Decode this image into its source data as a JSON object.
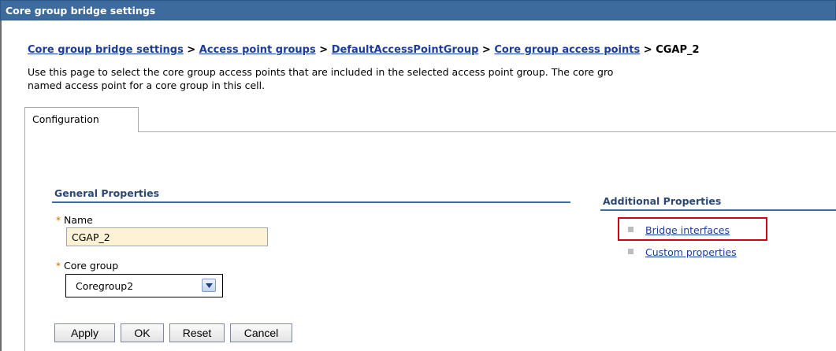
{
  "window": {
    "title": "Core group bridge settings"
  },
  "breadcrumb": {
    "items": [
      "Core group bridge settings",
      "Access point groups",
      "DefaultAccessPointGroup",
      "Core group access points"
    ],
    "separator": ">",
    "current": "CGAP_2"
  },
  "description": {
    "line1": "Use this page to select the core group access points that are included in the selected access point group. The core gro",
    "line2": "named access point for a core group in this cell."
  },
  "tabs": [
    {
      "label": "Configuration"
    }
  ],
  "general_properties": {
    "title": "General Properties",
    "required_marker": "*",
    "name": {
      "label": "Name",
      "value": "CGAP_2"
    },
    "core_group": {
      "label": "Core group",
      "selected": "Coregroup2"
    }
  },
  "buttons": {
    "apply": "Apply",
    "ok": "OK",
    "reset": "Reset",
    "cancel": "Cancel"
  },
  "additional_properties": {
    "title": "Additional Properties",
    "links": [
      {
        "label": "Bridge interfaces",
        "highlighted": true
      },
      {
        "label": "Custom properties",
        "highlighted": false
      }
    ]
  },
  "colors": {
    "title_bar": "#3e6b9e",
    "link": "#1a3d9e",
    "highlight": "#d0021b",
    "input_bg": "#fdf2d4"
  }
}
